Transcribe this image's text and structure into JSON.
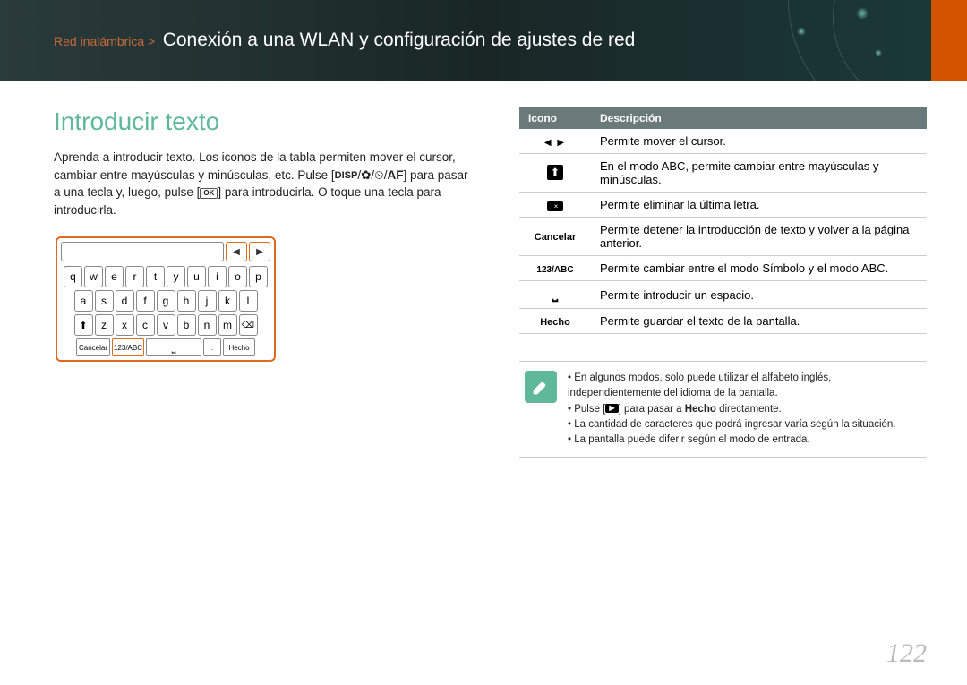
{
  "header": {
    "prefix": "Red inalámbrica >",
    "title": "Conexión a una WLAN y configuración de ajustes de red"
  },
  "section_title": "Introducir texto",
  "intro_parts": {
    "p1": "Aprenda a introducir texto. Los iconos de la tabla permiten mover el cursor, cambiar entre mayúsculas y minúsculas, etc. Pulse [",
    "disp": "DISP",
    "slash1": "/",
    "macro_icon": "✿",
    "slash2": "/",
    "timer_icon": "⏲",
    "slash3": "/",
    "af": "AF",
    "p2": "] para pasar a una tecla y, luego, pulse [",
    "ok_icon": "OK",
    "p3": "] para introducirla. O toque una tecla para introducirla."
  },
  "keyboard": {
    "row1": [
      "q",
      "w",
      "e",
      "r",
      "t",
      "y",
      "u",
      "i",
      "o",
      "p"
    ],
    "row2": [
      "a",
      "s",
      "d",
      "f",
      "g",
      "h",
      "j",
      "k",
      "l"
    ],
    "row3": [
      "z",
      "x",
      "c",
      "v",
      "b",
      "n",
      "m"
    ],
    "cancel": "Cancelar",
    "mode": "123/ABC",
    "dot": ".",
    "done": "Hecho"
  },
  "table": {
    "head_icon": "Icono",
    "head_desc": "Descripción",
    "rows": [
      {
        "icon_type": "arrows",
        "label": "",
        "desc": "Permite mover el cursor."
      },
      {
        "icon_type": "shift",
        "label": "",
        "desc": "En el modo ABC, permite cambiar entre mayúsculas y minúsculas."
      },
      {
        "icon_type": "back",
        "label": "",
        "desc": "Permite eliminar la última letra."
      },
      {
        "icon_type": "text",
        "label": "Cancelar",
        "desc": "Permite detener la introducción de texto y volver a la página anterior."
      },
      {
        "icon_type": "mode",
        "label": "123/ABC",
        "desc": "Permite cambiar entre el modo Símbolo y el modo ABC."
      },
      {
        "icon_type": "space",
        "label": "",
        "desc": "Permite introducir un espacio."
      },
      {
        "icon_type": "text",
        "label": "Hecho",
        "desc": "Permite guardar el texto de la pantalla."
      }
    ]
  },
  "notes": {
    "n1a": "En algunos modos, solo puede utilizar el alfabeto inglés, independientemente del idioma de la pantalla.",
    "n2_pre": "Pulse [",
    "n2_icon": "▶",
    "n2_post": "] para pasar a ",
    "n2_bold": "Hecho",
    "n2_end": " directamente.",
    "n3": "La cantidad de caracteres que podrá ingresar varía según la situación.",
    "n4": "La pantalla puede diferir según el modo de entrada."
  },
  "page_number": "122"
}
